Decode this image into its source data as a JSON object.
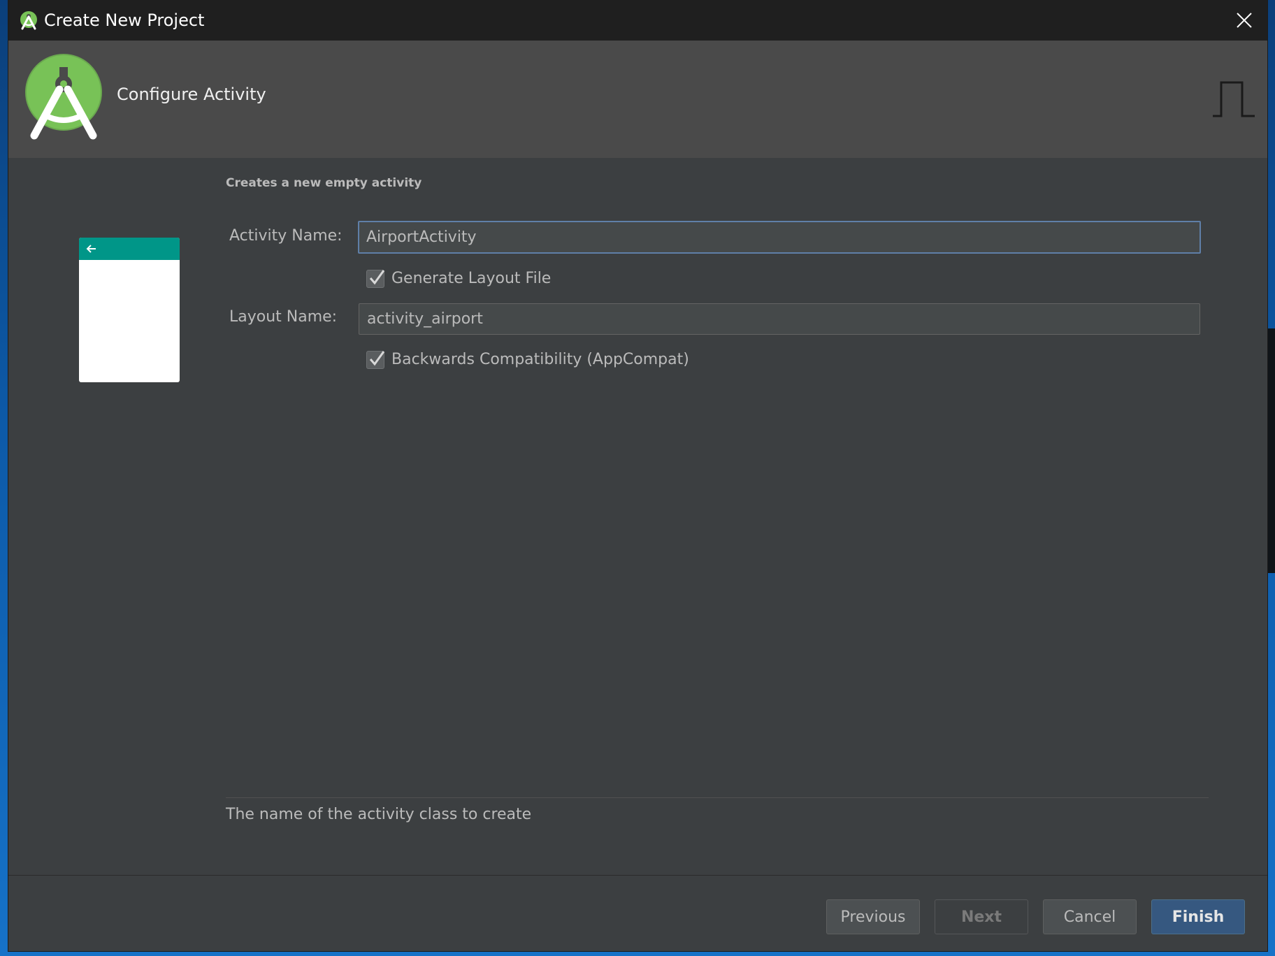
{
  "window": {
    "title": "Create New Project"
  },
  "header": {
    "title": "Configure Activity"
  },
  "form": {
    "description": "Creates a new empty activity",
    "activity_name": {
      "label": "Activity Name:",
      "value": "AirportActivity"
    },
    "generate_layout": {
      "label": "Generate Layout File",
      "checked": true
    },
    "layout_name": {
      "label": "Layout Name:",
      "value": "activity_airport"
    },
    "backwards_compat": {
      "label": "Backwards Compatibility (AppCompat)",
      "checked": true
    },
    "hint": "The name of the activity class to create"
  },
  "buttons": {
    "previous": "Previous",
    "next": "Next",
    "cancel": "Cancel",
    "finish": "Finish"
  },
  "colors": {
    "accent_green": "#78c257",
    "preview_toolbar": "#009688",
    "focus_border": "#5f7fa8",
    "primary_button": "#365880"
  },
  "icons": {
    "app": "android-studio-icon",
    "close": "close-icon",
    "preview_back": "arrow-left-icon",
    "header_glyph": "square-wave-icon",
    "checkbox": "checkmark-icon"
  }
}
